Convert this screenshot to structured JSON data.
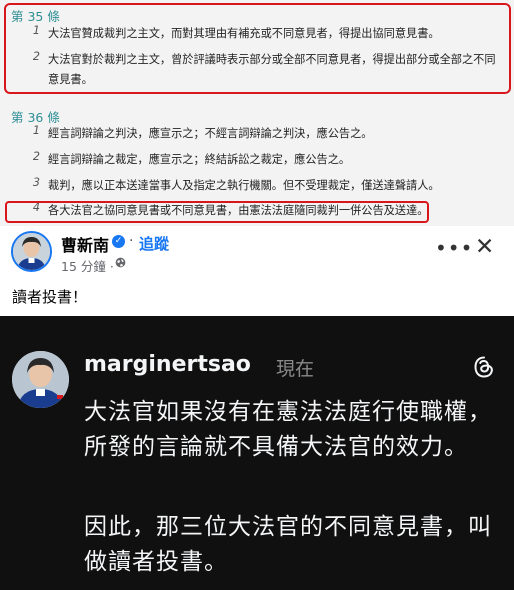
{
  "law": {
    "article35": {
      "heading": "第 35 條",
      "items": [
        {
          "num": "1",
          "text": "大法官贊成裁判之主文，而對其理由有補充或不同意見者，得提出協同意見書。"
        },
        {
          "num": "2",
          "text": "大法官對於裁判之主文，曾於評議時表示部分或全部不同意見者，得提出部分或全部之不同意見書。"
        }
      ]
    },
    "article36": {
      "heading": "第 36 條",
      "items": [
        {
          "num": "1",
          "text": "經言詞辯論之判決，應宣示之；不經言詞辯論之判決，應公告之。"
        },
        {
          "num": "2",
          "text": "經言詞辯論之裁定，應宣示之；終結訴訟之裁定，應公告之。"
        },
        {
          "num": "3",
          "text": "裁判，應以正本送達當事人及指定之執行機關。但不受理裁定，僅送達聲請人。"
        },
        {
          "num": "4",
          "text": "各大法官之協同意見書或不同意見書，由憲法法庭隨同裁判一併公告及送達。"
        }
      ]
    },
    "highlight_color": "#d9161c"
  },
  "facebook_post": {
    "author": "曹新南",
    "separator": "·",
    "follow_label": "追蹤",
    "time": "15 分鐘 ·",
    "text": "讀者投書！",
    "icons": [
      "verified-badge-icon",
      "globe-icon",
      "more-options-icon",
      "close-icon"
    ],
    "more_label": "•••",
    "close_label": "✕",
    "verified_label": "✓"
  },
  "threads_post": {
    "username": "marginertsao",
    "time": "現在",
    "paragraphs": [
      "大法官如果沒有在憲法法庭行使職權，所發的言論就不具備大法官的效力。",
      "因此，那三位大法官的不同意見書，叫做讀者投書。"
    ],
    "icons": [
      "threads-logo-icon"
    ]
  }
}
